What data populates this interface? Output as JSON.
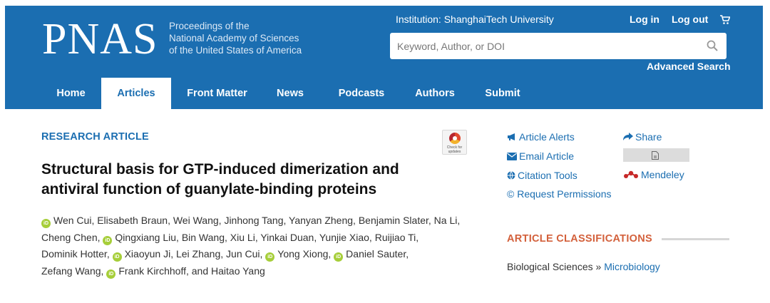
{
  "header": {
    "logo": "PNAS",
    "tagline": [
      "Proceedings of the",
      "National Academy of Sciences",
      "of the United States of America"
    ],
    "institution": "Institution: ShanghaiTech University",
    "login": "Log in",
    "logout": "Log out",
    "search_placeholder": "Keyword, Author, or DOI",
    "advanced_search": "Advanced Search",
    "colors": {
      "brand": "#1b6eb1",
      "accent": "#d3603b",
      "orcid": "#a6ce39"
    }
  },
  "nav": {
    "items": [
      "Home",
      "Articles",
      "Front Matter",
      "News",
      "Podcasts",
      "Authors",
      "Submit"
    ],
    "active": "Articles"
  },
  "article": {
    "section": "RESEARCH ARTICLE",
    "check_badge": "Check for updates",
    "title_line1": "Structural basis for GTP-induced dimerization and",
    "title_line2": "antiviral function of guanylate-binding proteins",
    "authors": [
      {
        "name": "Wen Cui",
        "orcid": true
      },
      {
        "name": "Elisabeth Braun",
        "orcid": false
      },
      {
        "name": "Wei Wang",
        "orcid": false
      },
      {
        "name": "Jinhong Tang",
        "orcid": false
      },
      {
        "name": "Yanyan Zheng",
        "orcid": false
      },
      {
        "name": "Benjamin Slater",
        "orcid": false
      },
      {
        "name": "Na Li",
        "orcid": false
      },
      {
        "name": "Cheng Chen",
        "orcid": false
      },
      {
        "name": "Qingxiang Liu",
        "orcid": true
      },
      {
        "name": "Bin Wang",
        "orcid": false
      },
      {
        "name": "Xiu Li",
        "orcid": false
      },
      {
        "name": "Yinkai Duan",
        "orcid": false
      },
      {
        "name": "Yunjie Xiao",
        "orcid": false
      },
      {
        "name": "Ruijiao Ti",
        "orcid": false
      },
      {
        "name": "Dominik Hotter",
        "orcid": false
      },
      {
        "name": "Xiaoyun Ji",
        "orcid": true
      },
      {
        "name": "Lei Zhang",
        "orcid": false
      },
      {
        "name": "Jun Cui",
        "orcid": false
      },
      {
        "name": "Yong Xiong",
        "orcid": true
      },
      {
        "name": "Daniel Sauter",
        "orcid": true
      },
      {
        "name": "Zefang Wang",
        "orcid": false
      },
      {
        "name": "Frank Kirchhoff",
        "orcid": true
      },
      {
        "name": "Haitao Yang",
        "orcid": false
      }
    ]
  },
  "tools": {
    "alerts": "Article Alerts",
    "email": "Email Article",
    "citation": "Citation Tools",
    "permissions": "© Request Permissions",
    "share": "Share",
    "mendeley": "Mendeley"
  },
  "classification": {
    "heading": "ARTICLE CLASSIFICATIONS",
    "primary": "Biological Sciences",
    "separator": " » ",
    "secondary": "Microbiology"
  }
}
